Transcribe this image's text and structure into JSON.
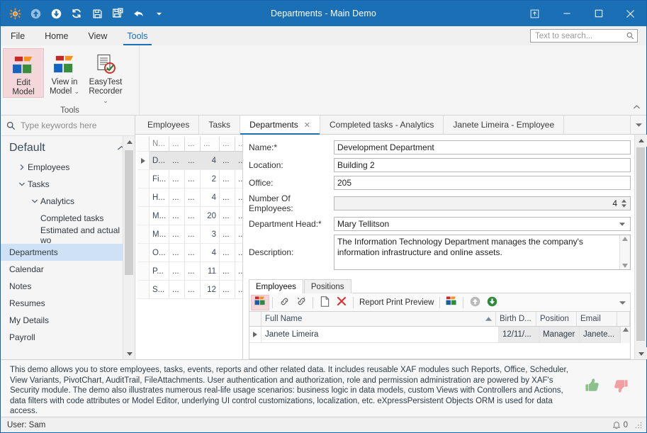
{
  "window": {
    "title": "Departments - Main Demo",
    "quick_access": [
      {
        "name": "app-menu-icon",
        "glyph": "sun"
      },
      {
        "name": "navigate-back-icon",
        "glyph": "up-circle"
      },
      {
        "name": "navigate-forward-icon",
        "glyph": "down-circle"
      },
      {
        "name": "refresh-icon",
        "glyph": "refresh"
      },
      {
        "name": "save-icon",
        "glyph": "save"
      },
      {
        "name": "save-and-close-icon",
        "glyph": "save-close"
      },
      {
        "name": "undo-icon",
        "glyph": "undo"
      },
      {
        "name": "customize-quick-access-icon",
        "glyph": "caret-down"
      }
    ],
    "controls": {
      "restore_layout": "restore-layout-icon",
      "minimize": "minimize-icon",
      "maximize": "maximize-icon",
      "close": "close-icon"
    }
  },
  "ribbon": {
    "tabs": [
      {
        "label": "File",
        "active": false
      },
      {
        "label": "Home",
        "active": false
      },
      {
        "label": "View",
        "active": false
      },
      {
        "label": "Tools",
        "active": true
      }
    ],
    "search": {
      "placeholder": "Text to search...",
      "value": ""
    },
    "group": {
      "label": "Tools",
      "buttons": [
        {
          "label": "Edit Model",
          "icon": "model-blocks-icon",
          "active": true,
          "has_dropdown": false
        },
        {
          "label": "View in Model",
          "icon": "model-blocks-icon",
          "active": false,
          "has_dropdown": true
        },
        {
          "label": "EasyTest Recorder",
          "icon": "document-check-icon",
          "active": false,
          "has_dropdown": true
        }
      ]
    },
    "collapse_icon": "chevron-up-icon"
  },
  "navpane": {
    "search": {
      "placeholder": "Type keywords here",
      "value": "",
      "icon": "search-icon"
    },
    "group_title": "Default",
    "group_collapse_icon": "chevron-up-icon",
    "items": [
      {
        "label": "Employees",
        "level": 1,
        "expander": "chevron-right-icon",
        "selected": false
      },
      {
        "label": "Tasks",
        "level": 1,
        "expander": "chevron-down-icon",
        "selected": false
      },
      {
        "label": "Analytics",
        "level": 2,
        "expander": "chevron-down-icon",
        "selected": false
      },
      {
        "label": "Completed tasks",
        "level": 3,
        "expander": "",
        "selected": false
      },
      {
        "label": "Estimated and actual wo",
        "level": 3,
        "expander": "",
        "selected": false
      },
      {
        "label": "Departments",
        "level": 0,
        "expander": "",
        "selected": true
      },
      {
        "label": "Calendar",
        "level": 0,
        "expander": "",
        "selected": false
      },
      {
        "label": "Notes",
        "level": 0,
        "expander": "",
        "selected": false
      },
      {
        "label": "Resumes",
        "level": 0,
        "expander": "",
        "selected": false
      },
      {
        "label": "My Details",
        "level": 0,
        "expander": "",
        "selected": false
      },
      {
        "label": "Payroll",
        "level": 0,
        "expander": "",
        "selected": false
      }
    ]
  },
  "document_tabs": [
    {
      "label": "Employees",
      "active": false,
      "closable": false
    },
    {
      "label": "Tasks",
      "active": false,
      "closable": false
    },
    {
      "label": "Departments",
      "active": true,
      "closable": true,
      "close_icon": "close-icon"
    },
    {
      "label": "Completed tasks - Analytics",
      "active": false,
      "closable": false
    },
    {
      "label": "Janete Limeira - Employee",
      "active": false,
      "closable": false
    }
  ],
  "tabstrip_menu_icon": "chevron-down-icon",
  "master_grid": {
    "headers": [
      "N...",
      "...",
      "...",
      "...",
      "...",
      "..."
    ],
    "rows": [
      {
        "cells": [
          "D...",
          "...",
          "...",
          "4",
          "...",
          "..."
        ],
        "selected": true
      },
      {
        "cells": [
          "Fi...",
          "...",
          "...",
          "2",
          "...",
          "..."
        ],
        "selected": false
      },
      {
        "cells": [
          "H...",
          "...",
          "...",
          "4",
          "...",
          "..."
        ],
        "selected": false
      },
      {
        "cells": [
          "M...",
          "...",
          "...",
          "20",
          "...",
          "..."
        ],
        "selected": false
      },
      {
        "cells": [
          "M...",
          "...",
          "...",
          "3",
          "...",
          "..."
        ],
        "selected": false
      },
      {
        "cells": [
          "O...",
          "...",
          "...",
          "4",
          "...",
          "..."
        ],
        "selected": false
      },
      {
        "cells": [
          "P...",
          "...",
          "...",
          "11",
          "...",
          "..."
        ],
        "selected": false
      },
      {
        "cells": [
          "S...",
          "...",
          "...",
          "12",
          "...",
          "..."
        ],
        "selected": false
      }
    ],
    "row_indicator_icon": "row-pointer-icon"
  },
  "detail_form": {
    "fields": [
      {
        "label": "Name:*",
        "value": "Development Department",
        "type": "text"
      },
      {
        "label": "Location:",
        "value": "Building 2",
        "type": "text"
      },
      {
        "label": "Office:",
        "value": "205",
        "type": "text"
      },
      {
        "label": "Number Of Employees:",
        "value": "4",
        "type": "spin",
        "readonly": true
      },
      {
        "label": "Department Head:*",
        "value": "Mary Tellitson",
        "type": "lookup"
      }
    ],
    "description": {
      "label": "Description:",
      "value": "The Information Technology Department manages the company's information infrastructure and online assets."
    }
  },
  "nested": {
    "tabs": [
      {
        "label": "Employees",
        "active": true
      },
      {
        "label": "Positions",
        "active": false
      }
    ],
    "toolbar": [
      {
        "name": "link-unlink-group-icon",
        "label": "",
        "icon": "blocks-icon",
        "active": true
      },
      {
        "name": "link-button",
        "label": "",
        "icon": "link-icon",
        "active": false
      },
      {
        "name": "unlink-button",
        "label": "",
        "icon": "unlink-icon",
        "active": false
      },
      {
        "name": "new-button",
        "label": "",
        "icon": "new-document-icon",
        "active": false
      },
      {
        "name": "delete-button",
        "label": "",
        "icon": "delete-x-icon",
        "active": false
      },
      {
        "name": "report-print-preview-button",
        "label": "Report Print Preview",
        "icon": "",
        "active": false
      },
      {
        "name": "export-button",
        "label": "",
        "icon": "chart-blocks-icon",
        "active": false
      },
      {
        "name": "move-up-button",
        "label": "",
        "icon": "up-circle-icon",
        "active": false
      },
      {
        "name": "move-down-button",
        "label": "",
        "icon": "down-circle-icon",
        "active": false
      }
    ],
    "toolbar_menu_icon": "chevron-down-icon",
    "grid": {
      "headers": [
        "Full Name",
        "Birth D...",
        "Position",
        "Email"
      ],
      "sort_icon": "sort-ascending-icon",
      "rows": [
        {
          "cells": [
            "Janete Limeira",
            "12/11/...",
            "Manager",
            "Janete..."
          ],
          "selected": true
        }
      ],
      "row_indicator_icon": "row-pointer-icon"
    }
  },
  "footer": {
    "description": "This demo allows you to store employees, tasks, events, reports and other related data. It includes reusable XAF modules such Reports, Office, Scheduler, View Variants, PivotChart, AuditTrail, FileAttachments. User authentication and authorization, role and permission administration are powered by XAF's Security module. The demo also illustrates numerous real-life usage scenarios: business logic in data models, custom Views with Controllers and Actions, data filters with code attributes or Model Editor, underlying UI control customizations, localization, etc. eXpressPersistent Objects ORM is used for data access.",
    "thumbs_up_icon": "thumbs-up-icon",
    "thumbs_down_icon": "thumbs-down-icon",
    "thumbs_up_color": "#8cc08c",
    "thumbs_down_color": "#f0a0a0"
  },
  "statusbar": {
    "user_label": "User: Sam",
    "notification_icon": "bell-icon",
    "notification_count": "0",
    "resize_grip_icon": "resize-grip-icon"
  },
  "colors": {
    "accent": "#1a6fb5",
    "selection": "#cfe2f5",
    "active_highlight": "#f3d7da"
  }
}
